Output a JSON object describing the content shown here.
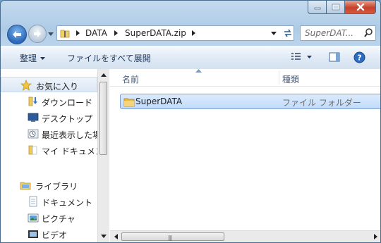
{
  "window": {
    "caption_buttons": [
      "minimize-icon",
      "maximize-icon",
      "close-icon"
    ]
  },
  "nav": {
    "back_icon": "back-arrow-icon",
    "forward_icon": "forward-arrow-icon",
    "address": {
      "crumbs": [
        "DATA",
        "SuperDATA.zip"
      ]
    },
    "search_placeholder": "SuperDAT..."
  },
  "toolbar": {
    "organize_label": "整理",
    "extract_all_label": "ファイルをすべて展開"
  },
  "sidebar": {
    "items": [
      {
        "label": "お気に入り",
        "icon": "star-icon"
      },
      {
        "label": "ダウンロード",
        "icon": "download-folder-icon"
      },
      {
        "label": "デスクトップ",
        "icon": "desktop-icon"
      },
      {
        "label": "最近表示した場",
        "icon": "recent-places-icon"
      },
      {
        "label": "マイ ドキュメン",
        "icon": "my-documents-icon"
      },
      {
        "label": "ライブラリ",
        "icon": "library-icon"
      },
      {
        "label": "ドキュメント",
        "icon": "documents-icon"
      },
      {
        "label": "ピクチャ",
        "icon": "pictures-icon"
      },
      {
        "label": "ビデオ",
        "icon": "videos-icon"
      }
    ]
  },
  "file_list": {
    "columns": [
      "名前",
      "種類"
    ],
    "rows": [
      {
        "name": "SuperDATA",
        "type": "ファイル フォルダー"
      }
    ]
  },
  "colors": {
    "frame": "#b9d3ec",
    "selection": "#c1dbfc",
    "close_button": "#c7402a"
  }
}
